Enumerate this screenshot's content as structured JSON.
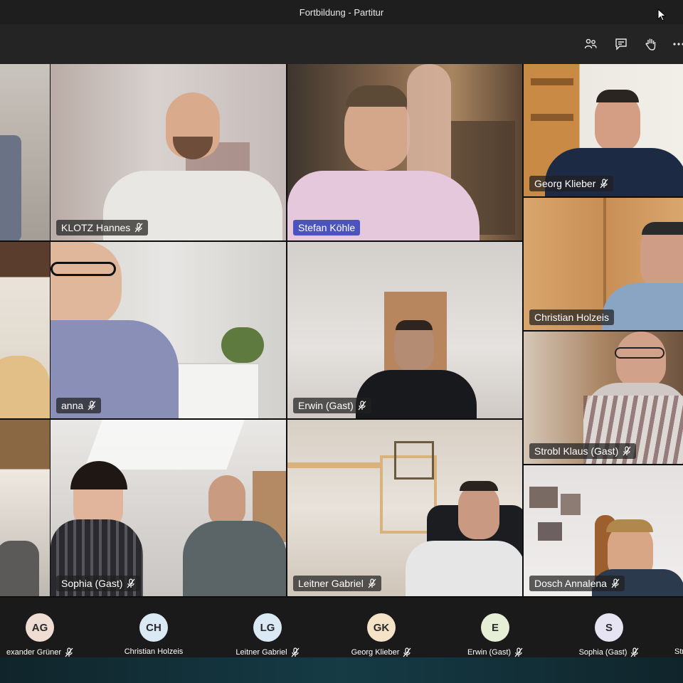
{
  "window": {
    "title": "Fortbildung - Partitur"
  },
  "toolbar": {
    "icons": [
      "participants-icon",
      "chat-icon",
      "raise-hand-icon",
      "more-options-icon"
    ]
  },
  "participants": [
    {
      "name": "",
      "mic_off": false,
      "speaking": false
    },
    {
      "name": "KLOTZ Hannes",
      "mic_off": true,
      "speaking": false
    },
    {
      "name": "Stefan Köhle",
      "mic_off": false,
      "speaking": true
    },
    {
      "name": "Georg Klieber",
      "mic_off": true,
      "speaking": false
    },
    {
      "name": "Christian Holzeis",
      "mic_off": false,
      "speaking": false
    },
    {
      "name": "",
      "mic_off": false,
      "speaking": false
    },
    {
      "name": "anna",
      "mic_off": true,
      "speaking": false
    },
    {
      "name": "Erwin (Gast)",
      "mic_off": true,
      "speaking": false
    },
    {
      "name": "Strobl Klaus (Gast)",
      "mic_off": true,
      "speaking": false
    },
    {
      "name": "",
      "mic_off": false,
      "speaking": false
    },
    {
      "name": "Sophia (Gast)",
      "mic_off": true,
      "speaking": false
    },
    {
      "name": "Leitner Gabriel",
      "mic_off": true,
      "speaking": false
    },
    {
      "name": "Dosch Annalena",
      "mic_off": true,
      "speaking": false
    }
  ],
  "strip": [
    {
      "initials": "AG",
      "name": "exander Grüner",
      "color": "#efdcd2"
    },
    {
      "initials": "CH",
      "name": "Christian Holzeis",
      "color": "#dbe9f5"
    },
    {
      "initials": "LG",
      "name": "Leitner Gabriel",
      "color": "#dbe9f5"
    },
    {
      "initials": "GK",
      "name": "Georg Klieber",
      "color": "#f5e3c8"
    },
    {
      "initials": "E",
      "name": "Erwin (Gast)",
      "color": "#e6efd6"
    },
    {
      "initials": "S",
      "name": "Sophia (Gast)",
      "color": "#e6e3f3"
    },
    {
      "initials": "",
      "name": "Str",
      "color": "#dbe9f5"
    }
  ],
  "colors": {
    "speaking_accent": "#4b53bc",
    "titlebar": "#1e1e1f",
    "toolbar": "#242425"
  }
}
